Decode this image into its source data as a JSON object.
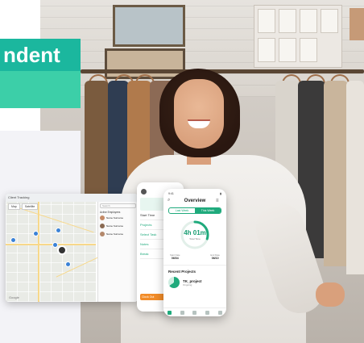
{
  "banner": {
    "text": "ndent"
  },
  "map_window": {
    "title": "Client Tracking",
    "toggle_map": "Map",
    "toggle_satellite": "Satellite",
    "search_placeholder": "Search",
    "list_header": "Active Employees",
    "people": [
      "Name Surname",
      "Name Surname",
      "Name Surname"
    ],
    "attribution": "Google"
  },
  "phone_back": {
    "rows": [
      "Start Time",
      "Projects",
      "Select Task",
      "Notes",
      "Break"
    ],
    "cta": "Clock Out"
  },
  "phone_front": {
    "time": "9:41",
    "title": "Overview",
    "tabs": [
      "Last Week",
      "This Week"
    ],
    "active_tab": 1,
    "ring_value": "4h 01m",
    "ring_label": "Total Time",
    "ring_fraction": 0.3,
    "date_start": "06/04",
    "date_start_label": "Start Date",
    "date_end": "06/10",
    "date_end_label": "End Date",
    "recent_title": "Recent Projects",
    "project_name": "TK_project",
    "project_sub": "Ongoing"
  },
  "colors": {
    "accent": "#1faa7c",
    "banner": "#1bb79e",
    "cta": "#f28c28"
  }
}
